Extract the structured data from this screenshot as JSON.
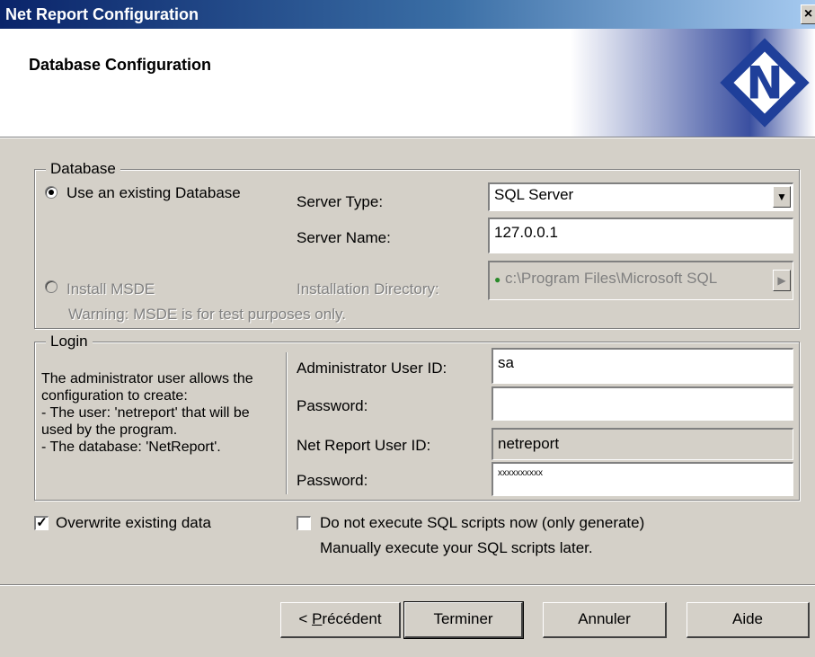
{
  "window": {
    "title": "Net Report Configuration",
    "close_glyph": "×"
  },
  "header": {
    "title": "Database Configuration",
    "logo_icon": "net-report-logo",
    "logo_letter": "N"
  },
  "database": {
    "legend": "Database",
    "use_existing_label": "Use an existing Database",
    "use_existing_selected": true,
    "server_type_label": "Server Type:",
    "server_type_value": "SQL Server",
    "server_name_label": "Server Name:",
    "server_name_value": "127.0.0.1",
    "install_msde_label": "Install MSDE",
    "install_msde_selected": false,
    "install_dir_label": "Installation Directory:",
    "install_dir_value": "c:\\Program Files\\Microsoft SQL",
    "warning": "Warning: MSDE is for test purposes only."
  },
  "login": {
    "legend": "Login",
    "description": "The administrator user allows the configuration to create:\n - The user: 'netreport' that will be used by the program.\n - The database: 'NetReport'.",
    "admin_id_label": "Administrator User ID:",
    "admin_id_value": "sa",
    "admin_pw_label": "Password:",
    "admin_pw_value": "",
    "netreport_id_label": "Net Report User ID:",
    "netreport_id_value": "netreport",
    "netreport_pw_label": "Password:",
    "netreport_pw_value": "xxxxxxxxxx"
  },
  "options": {
    "overwrite_label": "Overwrite existing data",
    "overwrite_checked": true,
    "noexec_label": "Do not execute SQL scripts now (only generate)",
    "noexec_sublabel": "Manually execute your SQL scripts later.",
    "noexec_checked": false
  },
  "buttons": {
    "back_prefix": "< ",
    "back_mnemonic": "P",
    "back_rest": "récédent",
    "finish": "Terminer",
    "cancel": "Annuler",
    "help": "Aide"
  },
  "colors": {
    "title_gradient_start": "#0a246a",
    "face": "#d4d0c8",
    "logo_blue": "#1f3f9a"
  }
}
